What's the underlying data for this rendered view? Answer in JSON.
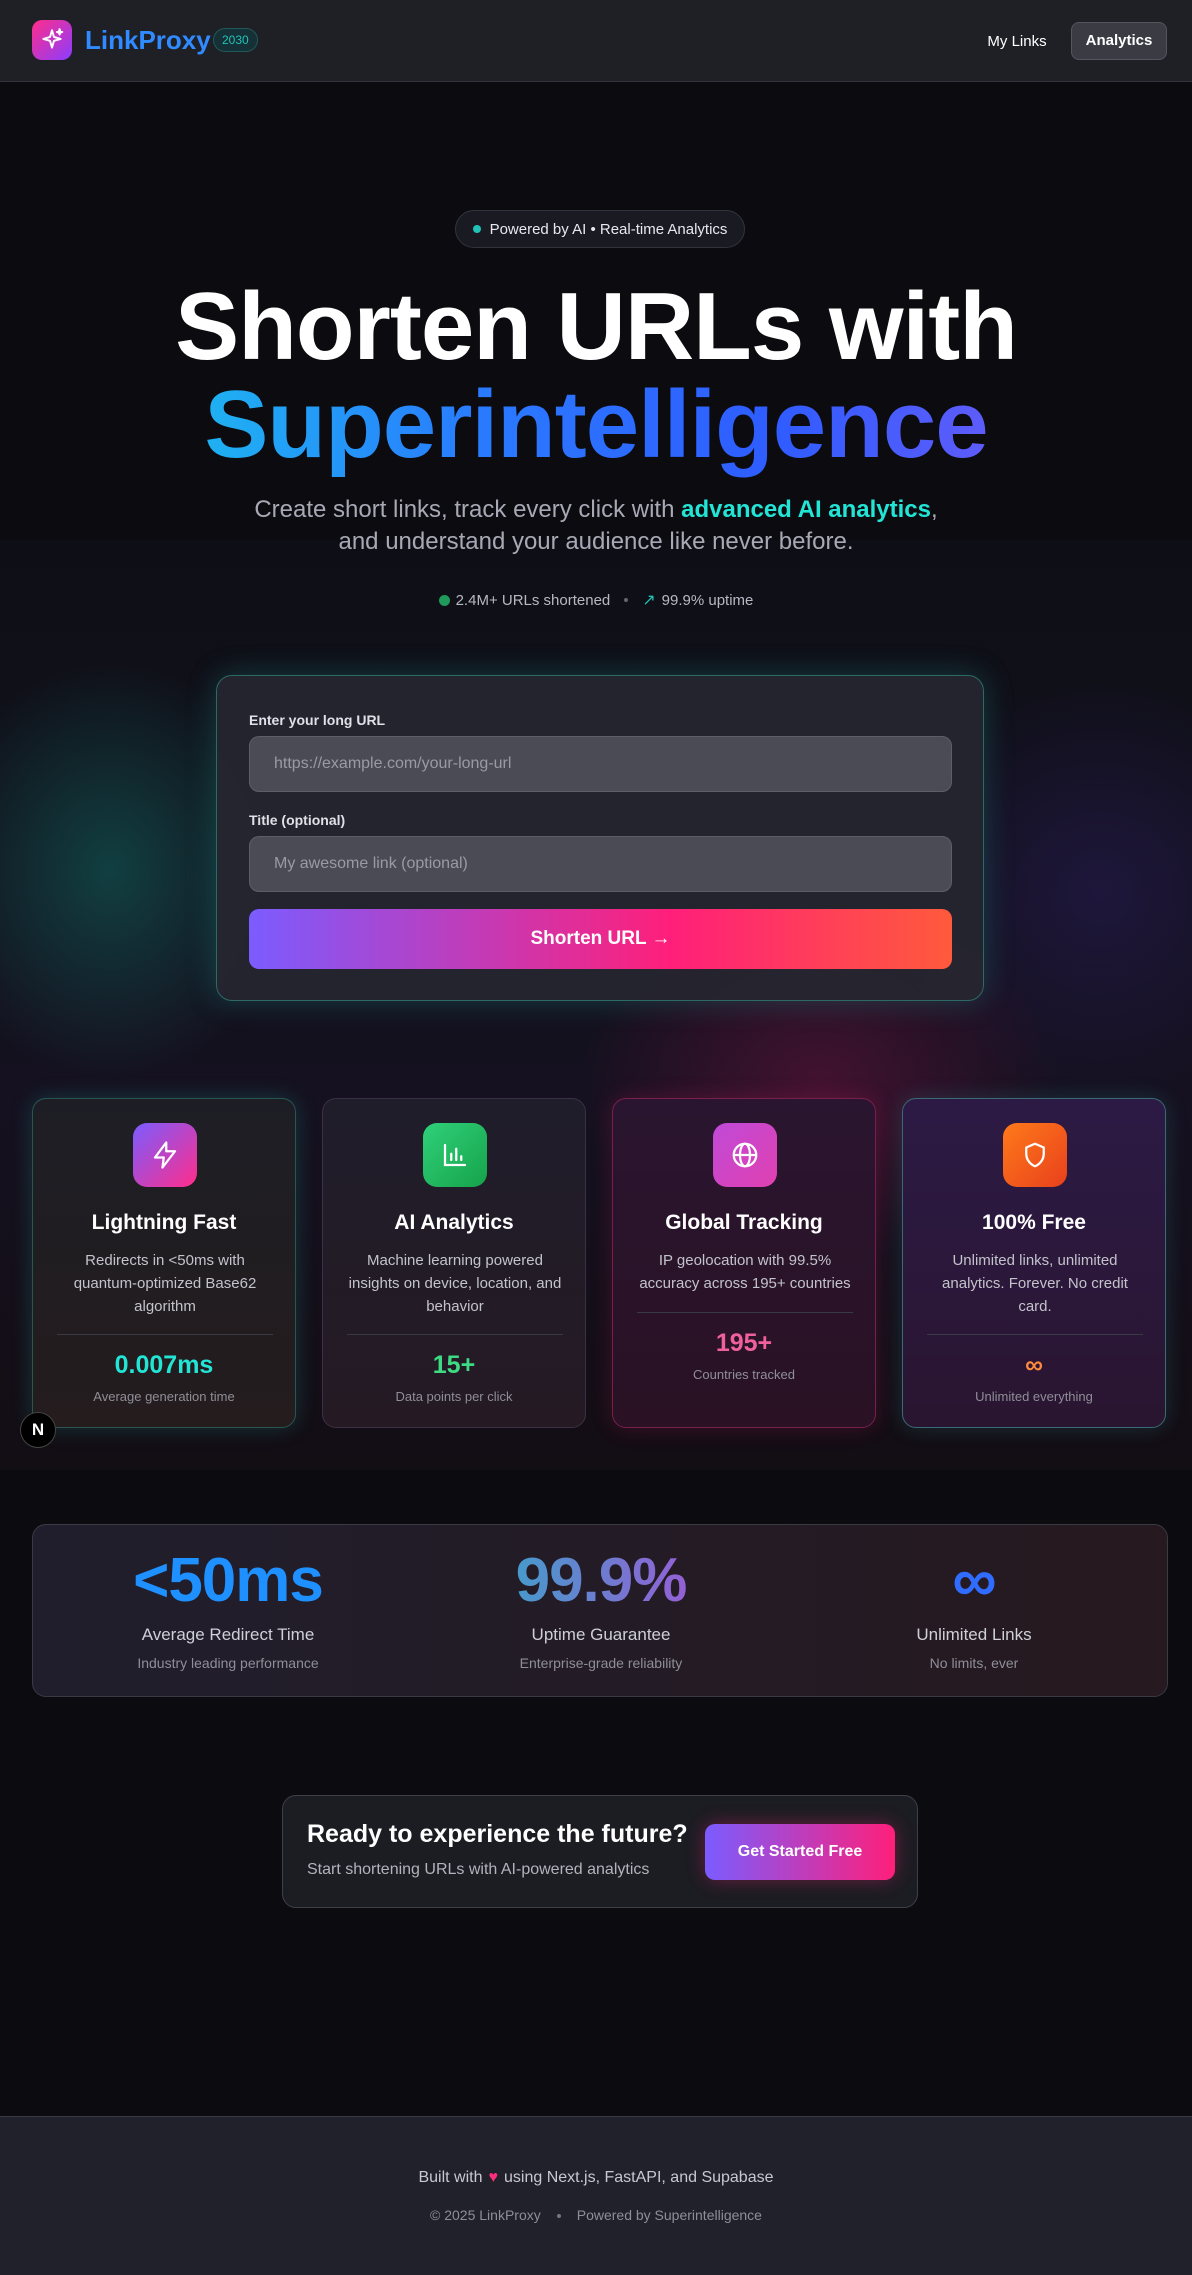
{
  "nav": {
    "brand": "LinkProxy",
    "badge": "2030",
    "my_links": "My Links",
    "analytics": "Analytics"
  },
  "hero": {
    "pill": "Powered by AI • Real-time Analytics",
    "title_line1": "Shorten URLs with",
    "title_line2": "Superintelligence",
    "sub_line1_a": "Create short links, track every click with ",
    "sub_line1_hl": "advanced AI analytics",
    "sub_line1_b": ",",
    "sub_line2": "and understand your audience like never before.",
    "stat1": "2.4M+ URLs shortened",
    "stat2": "99.9% uptime"
  },
  "form": {
    "url_label": "Enter your long URL",
    "url_placeholder": "https://example.com/your-long-url",
    "title_label": "Title (optional)",
    "title_placeholder": "My awesome link (optional)",
    "submit": "Shorten URL →"
  },
  "features": [
    {
      "title": "Lightning Fast",
      "desc": "Redirects in <50ms with quantum-optimized Base62 algorithm",
      "stat": "0.007ms",
      "caption": "Average generation time",
      "icon": "lightning-icon",
      "stat_color": "#22e5d6"
    },
    {
      "title": "AI Analytics",
      "desc": "Machine learning powered insights on device, location, and behavior",
      "stat": "15+",
      "caption": "Data points per click",
      "icon": "bar-chart-icon",
      "stat_color": "#3ddc84"
    },
    {
      "title": "Global Tracking",
      "desc": "IP geolocation with 99.5% accuracy across 195+ countries",
      "stat": "195+",
      "caption": "Countries tracked",
      "icon": "globe-icon",
      "stat_color": "#f0609e"
    },
    {
      "title": "100% Free",
      "desc": "Unlimited links, unlimited analytics. Forever. No credit card.",
      "stat": "∞",
      "caption": "Unlimited everything",
      "icon": "shield-icon",
      "stat_color": "#ff8a3c"
    }
  ],
  "badge_n": "N",
  "big_stats": [
    {
      "value": "<50ms",
      "title": "Average Redirect Time",
      "sub": "Industry leading performance"
    },
    {
      "value": "99.9%",
      "title": "Uptime Guarantee",
      "sub": "Enterprise-grade reliability"
    },
    {
      "value": "∞",
      "title": "Unlimited Links",
      "sub": "No limits, ever"
    }
  ],
  "cta": {
    "title": "Ready to experience the future?",
    "sub": "Start shortening URLs with AI-powered analytics",
    "button": "Get Started Free"
  },
  "footer": {
    "built_a": "Built with",
    "heart": "♥",
    "built_b": "using Next.js, FastAPI, and Supabase",
    "copyright": "© 2025 LinkProxy",
    "powered": "Powered by Superintelligence"
  },
  "colors": {
    "accent_cyan": "#22e5d6",
    "accent_blue": "#2f8bff",
    "accent_pink": "#ff1f7a",
    "accent_purple": "#7b5cff"
  }
}
